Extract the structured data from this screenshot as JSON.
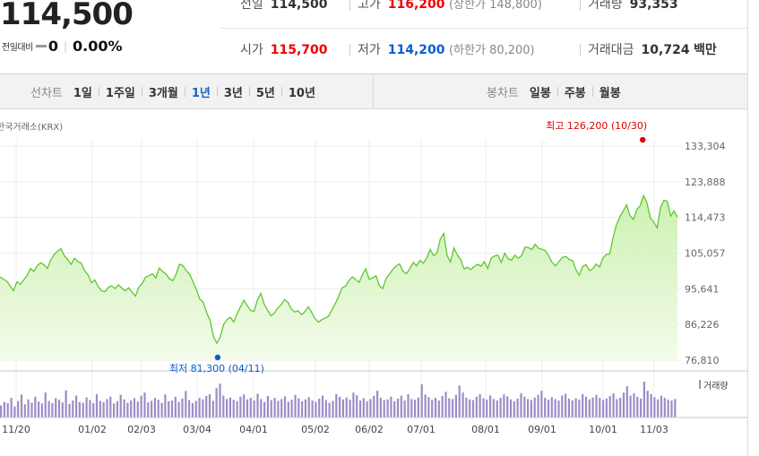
{
  "price": {
    "current": "114,500",
    "change_label": "전일대비",
    "change_value": "0",
    "change_pct": "0.00%"
  },
  "summary": {
    "row1": [
      {
        "label": "전일",
        "value": "114,500"
      },
      {
        "label": "고가",
        "value": "116,200",
        "sub": "(상한가 148,800)"
      },
      {
        "label": "거래량",
        "value": "93,353"
      }
    ],
    "row2": [
      {
        "label": "시가",
        "value": "115,700"
      },
      {
        "label": "저가",
        "value": "114,200",
        "sub": "(하한가 80,200)"
      },
      {
        "label": "거래대금",
        "value": "10,724",
        "unit": "백만"
      }
    ]
  },
  "tabs": {
    "line_label": "선차트",
    "line_items": [
      "1일",
      "1주일",
      "3개월",
      "1년",
      "3년",
      "5년",
      "10년"
    ],
    "line_active": "1년",
    "candle_label": "봉차트",
    "candle_items": [
      "일봉",
      "주봉",
      "월봉"
    ]
  },
  "colors": {
    "line": "#5fc72f",
    "fill_top": "#cdf1b2",
    "fill_bottom": "#f3fbea",
    "up": "#e00000",
    "down": "#0a5dd6",
    "volume": "#9d8cc7"
  },
  "chart_data": {
    "type": "area",
    "source": "한국거래소(KRX)",
    "y_ticks": [
      133304,
      123888,
      114473,
      105057,
      95641,
      86226,
      76810
    ],
    "ylim": [
      76810,
      133304
    ],
    "x_labels": [
      "11/20",
      "01/02",
      "02/03",
      "03/04",
      "04/01",
      "05/02",
      "06/02",
      "07/01",
      "08/01",
      "09/01",
      "10/01",
      "11/03"
    ],
    "high": {
      "label": "최고",
      "value": 126200,
      "date": "10/30",
      "text": "최고 126,200 (10/30)"
    },
    "low": {
      "label": "최저",
      "value": 81300,
      "date": "04/11",
      "text": "최저 81,300 (04/11)"
    },
    "volume_label": "거래량",
    "series": [
      {
        "name": "종가",
        "values": [
          98800,
          98200,
          97600,
          96400,
          95100,
          97500,
          96800,
          98000,
          99100,
          101000,
          100200,
          101700,
          102500,
          102000,
          101000,
          103300,
          104700,
          105600,
          106200,
          104400,
          103300,
          102100,
          103700,
          102800,
          102400,
          100400,
          99300,
          97200,
          98000,
          96200,
          95100,
          94900,
          96000,
          96400,
          95700,
          96700,
          95800,
          95100,
          95900,
          94700,
          93700,
          96100,
          97100,
          98700,
          99100,
          99600,
          98500,
          101100,
          100200,
          99600,
          98300,
          97800,
          99500,
          102100,
          101800,
          100400,
          99500,
          97400,
          95400,
          92900,
          92100,
          89300,
          87300,
          83100,
          81300,
          82800,
          86200,
          87500,
          88100,
          86900,
          89000,
          90900,
          92600,
          91200,
          89900,
          89700,
          92700,
          94400,
          91600,
          90000,
          88500,
          89200,
          90600,
          91400,
          92800,
          92100,
          90300,
          89500,
          89800,
          88800,
          89600,
          90900,
          89400,
          87800,
          86800,
          87500,
          87900,
          88400,
          90100,
          91700,
          93700,
          95900,
          96300,
          97800,
          98800,
          98100,
          97300,
          99400,
          100900,
          98100,
          98500,
          99100,
          96400,
          95700,
          98400,
          99500,
          100800,
          101700,
          102200,
          100200,
          99600,
          101000,
          102600,
          101700,
          103100,
          102400,
          103800,
          106000,
          104400,
          105000,
          108800,
          110200,
          104400,
          102700,
          106400,
          104600,
          103300,
          100900,
          101300,
          100700,
          101500,
          102100,
          101600,
          102800,
          101000,
          103700,
          104300,
          104500,
          102600,
          105000,
          103600,
          103200,
          104500,
          103700,
          104400,
          106600,
          106500,
          106000,
          107400,
          106300,
          106100,
          105700,
          104300,
          102600,
          101700,
          102800,
          103900,
          104200,
          103400,
          103100,
          100700,
          99200,
          101500,
          102000,
          100500,
          100900,
          102200,
          101400,
          103700,
          104700,
          104800,
          109200,
          112600,
          114600,
          116200,
          117800,
          114900,
          113900,
          116500,
          117600,
          120200,
          118300,
          114300,
          113300,
          111700,
          117100,
          119000,
          118700,
          114800,
          116200,
          114500
        ]
      }
    ],
    "volume": [
      32,
      41,
      38,
      52,
      29,
      44,
      61,
      35,
      48,
      39,
      55,
      42,
      37,
      66,
      44,
      38,
      51,
      47,
      40,
      72,
      36,
      45,
      58,
      41,
      39,
      53,
      46,
      38,
      62,
      44,
      41,
      49,
      55,
      37,
      43,
      60,
      48,
      39,
      45,
      51,
      42,
      58,
      66,
      40,
      44,
      52,
      47,
      39,
      61,
      43,
      45,
      55,
      41,
      50,
      70,
      46,
      38,
      44,
      52,
      48,
      57,
      62,
      44,
      78,
      90,
      58,
      49,
      53,
      47,
      43,
      55,
      61,
      48,
      52,
      45,
      63,
      49,
      41,
      57,
      46,
      52,
      44,
      49,
      56,
      42,
      47,
      60,
      51,
      43,
      48,
      54,
      45,
      41,
      50,
      58,
      46,
      39,
      44,
      62,
      55,
      48,
      53,
      47,
      66,
      59,
      45,
      51,
      43,
      49,
      57,
      71,
      52,
      46,
      48,
      55,
      43,
      50,
      58,
      45,
      62,
      49,
      47,
      53,
      88,
      61,
      54,
      47,
      52,
      45,
      57,
      68,
      51,
      49,
      60,
      85,
      66,
      53,
      48,
      46,
      55,
      62,
      51,
      47,
      58,
      49,
      45,
      52,
      61,
      56,
      48,
      43,
      50,
      64,
      55,
      49,
      46,
      53,
      60,
      71,
      52,
      47,
      54,
      49,
      45,
      58,
      63,
      50,
      45,
      51,
      47,
      62,
      55,
      48,
      53,
      60,
      52,
      46,
      50,
      57,
      64,
      49,
      52,
      66,
      83,
      58,
      64,
      55,
      50,
      95,
      71,
      62,
      54,
      48,
      58,
      52,
      47,
      45,
      49
    ]
  }
}
